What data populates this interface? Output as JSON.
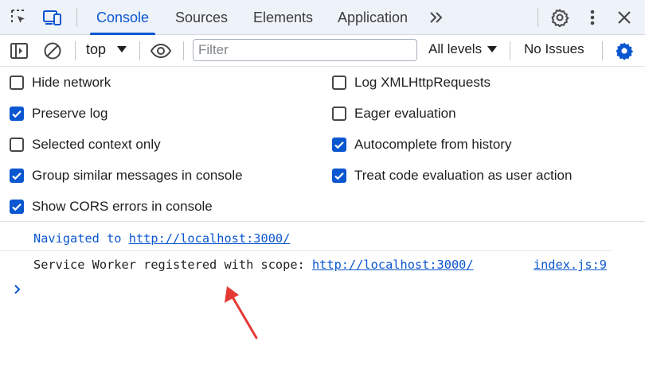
{
  "tabbar": {
    "icons": [
      "inspect-element-icon",
      "device-toolbar-icon"
    ],
    "tabs": [
      {
        "label": "Console",
        "active": true
      },
      {
        "label": "Sources",
        "active": false
      },
      {
        "label": "Elements",
        "active": false
      },
      {
        "label": "Application",
        "active": false
      }
    ],
    "more_tabs_icon": "chevron-double-right-icon",
    "right_icons": [
      "gear-icon",
      "kebab-menu-icon",
      "close-icon"
    ]
  },
  "toolbar": {
    "icons": [
      "sidebar-toggle-icon",
      "clear-console-icon",
      "eye-icon",
      "settings-gear-icon"
    ],
    "context": "top",
    "filter_placeholder": "Filter",
    "levels": "All levels",
    "issues": "No Issues"
  },
  "settings": {
    "left": [
      {
        "label": "Hide network",
        "checked": false
      },
      {
        "label": "Preserve log",
        "checked": true
      },
      {
        "label": "Selected context only",
        "checked": false
      },
      {
        "label": "Group similar messages in console",
        "checked": true
      },
      {
        "label": "Show CORS errors in console",
        "checked": true
      }
    ],
    "right": [
      {
        "label": "Log XMLHttpRequests",
        "checked": false
      },
      {
        "label": "Eager evaluation",
        "checked": false
      },
      {
        "label": "Autocomplete from history",
        "checked": true
      },
      {
        "label": "Treat code evaluation as user action",
        "checked": true
      }
    ]
  },
  "console": {
    "nav_prefix": "Navigated to ",
    "nav_url": "http://localhost:3000/",
    "log_prefix": "Service Worker registered with scope: ",
    "log_url": "http://localhost:3000/",
    "log_source": "index.js:9"
  },
  "colors": {
    "accent": "#0b57d0",
    "annotation_arrow": "#e53935",
    "tabbar_bg": "#eef2f9"
  }
}
